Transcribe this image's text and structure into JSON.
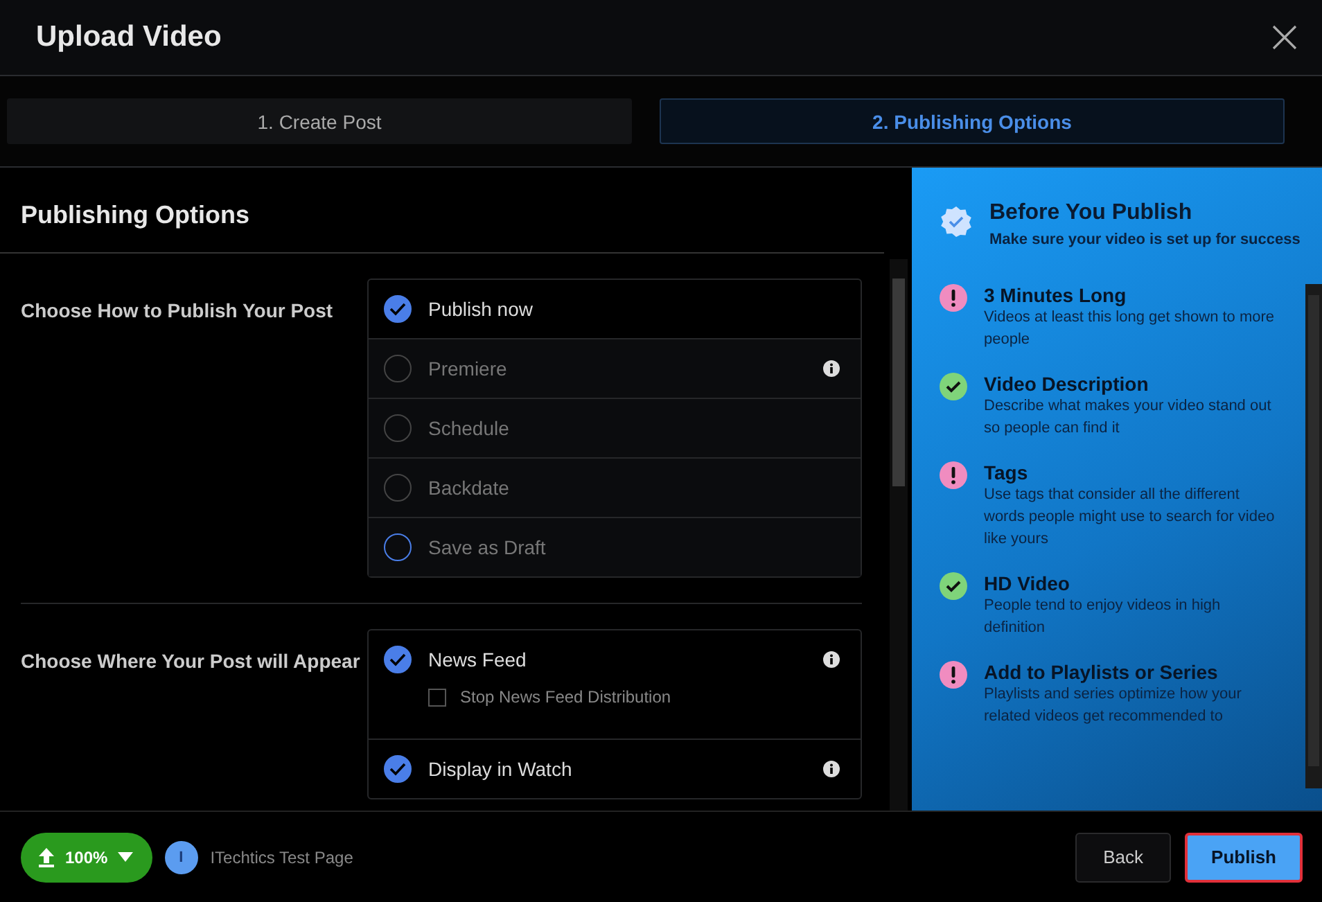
{
  "window": {
    "title": "Upload Video"
  },
  "tabs": [
    {
      "label": "1. Create Post",
      "selected": false
    },
    {
      "label": "2. Publishing Options",
      "selected": true
    }
  ],
  "publishing": {
    "title": "Publishing Options",
    "how": {
      "label": "Choose How to Publish Your Post",
      "options": [
        {
          "label": "Publish now",
          "selected": true,
          "disabled": false,
          "focused": false,
          "info": false
        },
        {
          "label": "Premiere",
          "selected": false,
          "disabled": true,
          "focused": false,
          "info": true
        },
        {
          "label": "Schedule",
          "selected": false,
          "disabled": true,
          "focused": false,
          "info": false
        },
        {
          "label": "Backdate",
          "selected": false,
          "disabled": true,
          "focused": false,
          "info": false
        },
        {
          "label": "Save as Draft",
          "selected": false,
          "disabled": true,
          "focused": true,
          "info": false
        }
      ]
    },
    "where": {
      "label": "Choose Where Your Post will Appear",
      "placements": [
        {
          "label": "News Feed",
          "checked": true,
          "info": true,
          "sub": {
            "label": "Stop News Feed Distribution",
            "checked": false
          }
        },
        {
          "label": "Display in Watch",
          "checked": true,
          "info": true
        }
      ]
    }
  },
  "checklist": {
    "title": "Before You Publish",
    "subtitle": "Make sure your video is set up for success",
    "items": [
      {
        "kind": "warning",
        "title": "3 Minutes Long",
        "text": "Videos at least this long get shown to more people"
      },
      {
        "kind": "done",
        "title": "Video Description",
        "text": "Describe what makes your video stand out so people can find it"
      },
      {
        "kind": "warning",
        "title": "Tags",
        "text": "Use tags that consider all the different words people might use to search for video like yours"
      },
      {
        "kind": "done",
        "title": "HD Video",
        "text": "People tend to enjoy videos in high definition"
      },
      {
        "kind": "warning",
        "title": "Add to Playlists or Series",
        "text": "Playlists and series optimize how your related videos get recommended to"
      }
    ]
  },
  "footer": {
    "upload": "100%",
    "avatar": "I",
    "page": "ITechtics Test Page",
    "buttons": [
      {
        "label": "Back",
        "kind": "secondary"
      },
      {
        "label": "Publish",
        "kind": "primary"
      }
    ]
  }
}
